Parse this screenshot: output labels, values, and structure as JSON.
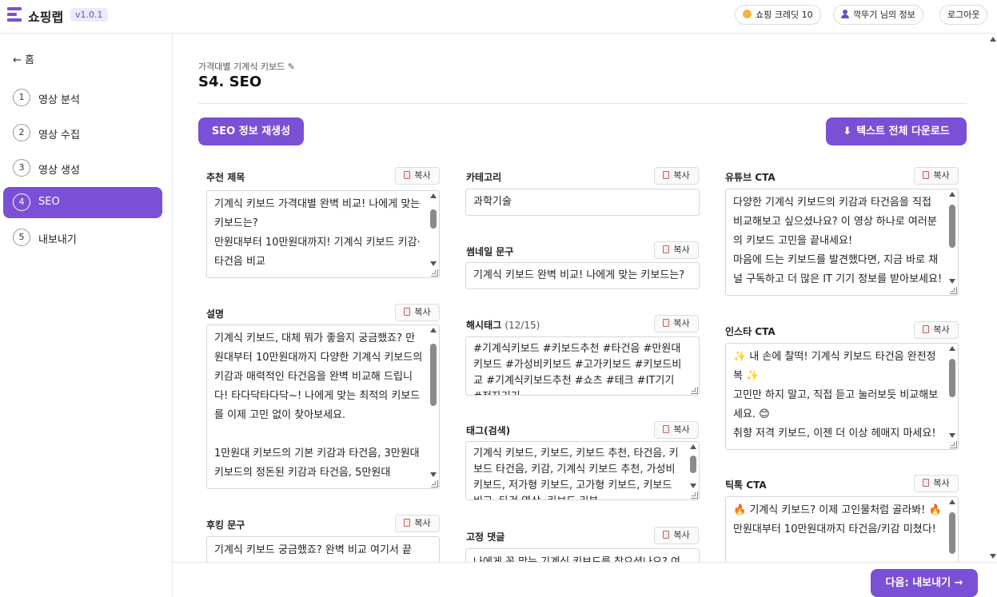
{
  "header": {
    "app_title": "쇼핑랩",
    "version": "v1.0.1",
    "credit": "쇼핑 크레딧 10",
    "user_info": "깍뚜기 님의 정보",
    "logout": "로그아웃"
  },
  "sidebar": {
    "home": "← 홈",
    "steps": [
      {
        "num": "1",
        "label": "영상 분석"
      },
      {
        "num": "2",
        "label": "영상 수집"
      },
      {
        "num": "3",
        "label": "영상 생성"
      },
      {
        "num": "4",
        "label": "SEO"
      },
      {
        "num": "5",
        "label": "내보내기"
      }
    ]
  },
  "main": {
    "breadcrumb": "가격대별 기계식 키보드 ✎",
    "title": "S4. SEO",
    "regen_button": "SEO 정보 재생성",
    "download_button": "텍스트 전체 다운로드",
    "copy_label": "복사",
    "fields": {
      "recommended_title": {
        "label": "추천 제목",
        "text": "기계식 키보드 가격대별 완벽 비교! 나에게 맞는 키보드는?\n만원대부터 10만원대까지! 기계식 키보드 키감·타건음 비교"
      },
      "description": {
        "label": "설명",
        "text": "기계식 키보드, 대체 뭐가 좋을지 궁금했죠? 만원대부터 10만원대까지 다양한 기계식 키보드의 키감과 매력적인 타건음을 완벽 비교해 드립니다! 타다닥타다닥~! 나에게 맞는 최적의 키보드를 이제 고민 없이 찾아보세요.\n\n1만원대 키보드의 기본 키감과 타건음, 3만원대 키보드의 정돈된 키감과 타건음, 5만원대"
      },
      "hooking": {
        "label": "후킹 문구",
        "text": "기계식 키보드 궁금했죠? 완벽 비교 여기서 끝"
      },
      "category": {
        "label": "카테고리",
        "text": "과학기술"
      },
      "thumbnail": {
        "label": "썸네일 문구",
        "text": "기계식 키보드 완벽 비교! 나에게 맞는 키보드는?"
      },
      "hashtags": {
        "label": "해시태그",
        "count": "(12/15)",
        "text": "#기계식키보드 #키보드추천 #타건음 #만원대키보드 #가성비키보드 #고가키보드 #키보드비교 #기계식키보드추천 #쇼츠 #테크 #IT기기 #전자기기"
      },
      "tags": {
        "label": "태그(검색)",
        "text": "기계식 키보드, 키보드, 키보드 추천, 타건음, 키보드 타건음, 키감, 기계식 키보드 추천, 가성비 키보드, 저가형 키보드, 고가형 키보드, 키보드 비교, 타건 영상, 키보드 리뷰"
      },
      "pinned_comment": {
        "label": "고정 댓글",
        "text": "나에게 꼭 맞는 기계식 키보드를 찾으셨나요? 여"
      },
      "youtube_cta": {
        "label": "유튜브 CTA",
        "text": "다양한 기계식 키보드의 키감과 타건음을 직접 비교해보고 싶으셨나요? 이 영상 하나로 여러분의 키보드 고민을 끝내세요!\n마음에 드는 키보드를 발견했다면, 지금 바로 채널 구독하고 더 많은 IT 기기 정보를 받아보세요!"
      },
      "insta_cta": {
        "label": "인스타 CTA",
        "text": "✨ 내 손에 찰떡! 기계식 키보드 타건음 완전정복 ✨\n고민만 하지 말고, 직접 듣고 눌러보듯 비교해보세요. 😊\n취향 저격 키보드, 이젠 더 이상 헤매지 마세요!"
      },
      "tiktok_cta": {
        "label": "틱톡 CTA",
        "text": "🔥 기계식 키보드? 이제 고인물처럼 골라봐! 🔥\n만원대부터 10만원대까지 타건음/키감 미쳤다!"
      }
    }
  },
  "footer": {
    "next_button": "다음: 내보내기 →"
  },
  "colors": {
    "accent": "#7b4fd6",
    "badge_bg": "#efe9fb"
  }
}
